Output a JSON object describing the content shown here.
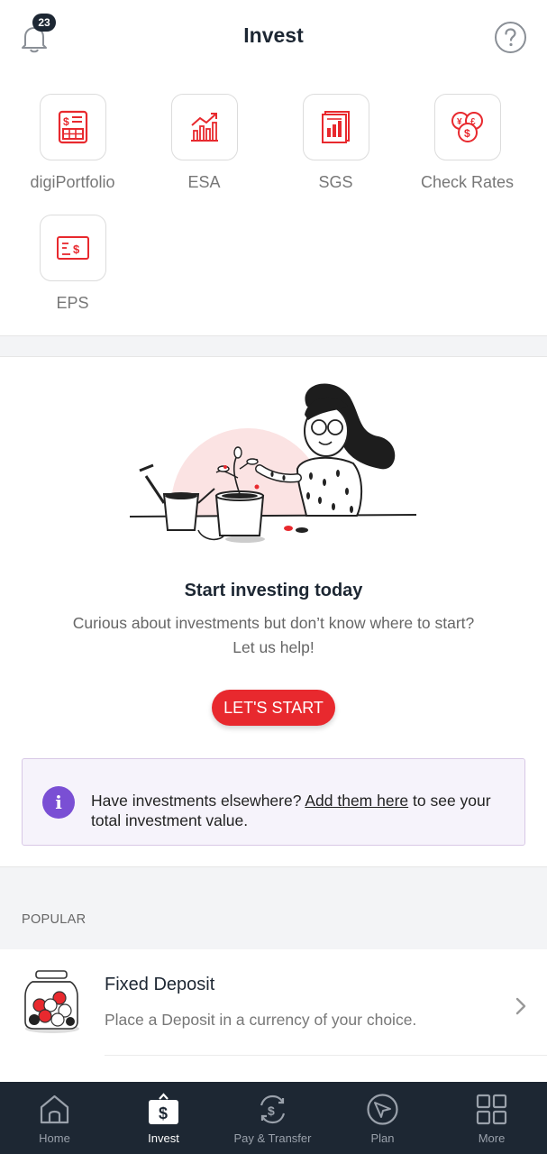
{
  "header": {
    "title": "Invest",
    "notification_count": "23",
    "icons": {
      "bell": "bell-icon",
      "help": "help-icon"
    }
  },
  "tiles": [
    {
      "label": "digiPortfolio",
      "icon": "portfolio-icon"
    },
    {
      "label": "ESA",
      "icon": "chart-growth-icon"
    },
    {
      "label": "SGS",
      "icon": "document-chart-icon"
    },
    {
      "label": "Check Rates",
      "icon": "currency-exchange-icon"
    },
    {
      "label": "EPS",
      "icon": "cheque-icon"
    }
  ],
  "hero": {
    "title": "Start investing today",
    "subtitle": "Curious about investments but don’t know where to start? Let us help!",
    "button": "LET'S START"
  },
  "info": {
    "prefix": "Have investments elsewhere? ",
    "link": "Add them here",
    "suffix": " to see your total investment value."
  },
  "popular": {
    "heading": "POPULAR",
    "items": [
      {
        "name": "Fixed Deposit",
        "description": "Place a Deposit in a currency of your choice."
      }
    ]
  },
  "nav": {
    "items": [
      {
        "label": "Home",
        "icon": "home-icon"
      },
      {
        "label": "Invest",
        "icon": "invest-bag-icon"
      },
      {
        "label": "Pay & Transfer",
        "icon": "transfer-icon"
      },
      {
        "label": "Plan",
        "icon": "plan-icon"
      },
      {
        "label": "More",
        "icon": "grid-icon"
      }
    ],
    "active": "Invest"
  },
  "colors": {
    "accent": "#e8292e",
    "nav_bg": "#1d2733",
    "info_icon": "#7a4fd4"
  }
}
